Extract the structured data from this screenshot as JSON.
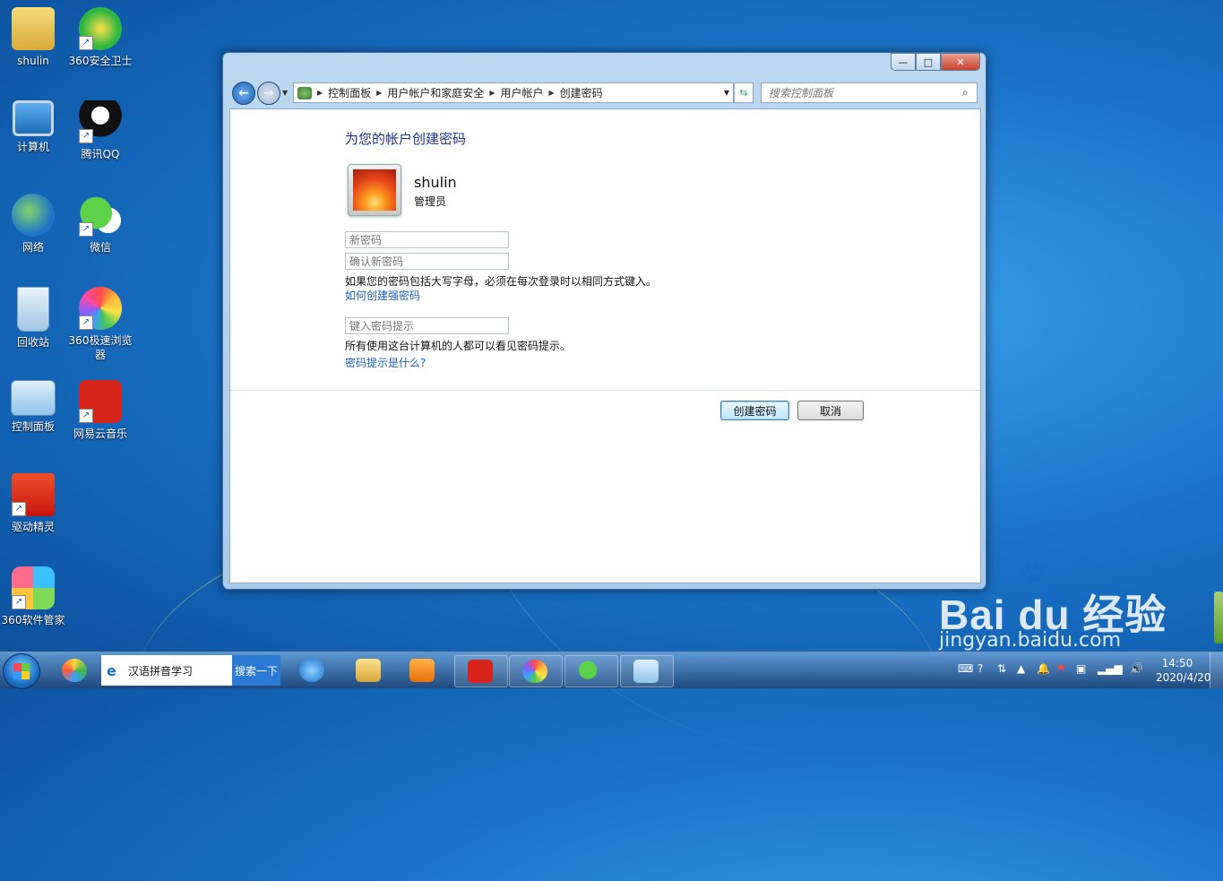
{
  "desktop": {
    "icons": [
      {
        "label": "shulin"
      },
      {
        "label": "360安全卫士"
      },
      {
        "label": "计算机"
      },
      {
        "label": "腾讯QQ"
      },
      {
        "label": "网络"
      },
      {
        "label": "微信"
      },
      {
        "label": "回收站"
      },
      {
        "label": "360极速浏览器"
      },
      {
        "label": "控制面板"
      },
      {
        "label": "网易云音乐"
      },
      {
        "label": "驱动精灵"
      },
      {
        "label": "360软件管家"
      }
    ]
  },
  "window": {
    "caption_buttons": {
      "minimize": "—",
      "maximize": "□",
      "close": "✕"
    },
    "address": {
      "crumbs": [
        "控制面板",
        "用户帐户和家庭安全",
        "用户帐户",
        "创建密码"
      ]
    },
    "search_placeholder": "搜索控制面板",
    "page_title": "为您的帐户创建密码",
    "user": {
      "name": "shulin",
      "role": "管理员"
    },
    "fields": {
      "new_password_placeholder": "新密码",
      "confirm_password_placeholder": "确认新密码",
      "hint_placeholder": "键入密码提示"
    },
    "caps_note": "如果您的密码包括大写字母，必须在每次登录时以相同方式键入。",
    "strong_link": "如何创建强密码",
    "hint_note": "所有使用这台计算机的人都可以看见密码提示。",
    "hint_link": "密码提示是什么?",
    "buttons": {
      "create": "创建密码",
      "cancel": "取消"
    }
  },
  "taskbar": {
    "search_text": "汉语拼音学习",
    "search_button": "搜索一下",
    "time": "14:50",
    "date": "2020/4/20"
  },
  "watermark": {
    "brand": "Bai du 经验",
    "url": "jingyan.baidu.com"
  }
}
